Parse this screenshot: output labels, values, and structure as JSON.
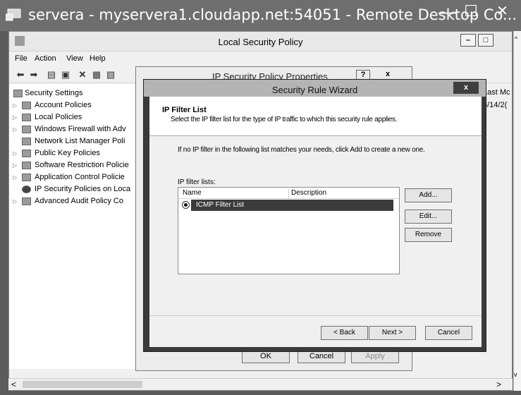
{
  "remote_desktop": {
    "title": "servera - myservera1.cloudapp.net:54051 - Remote Desktop Co...",
    "minimize": "—",
    "maximize": "☐",
    "close": "✕"
  },
  "lsp": {
    "title": "Local Security Policy",
    "min": "–",
    "max": "□",
    "menu": [
      "File",
      "Action",
      "View",
      "Help"
    ],
    "tree": [
      {
        "label": "Security Settings",
        "indent": 0,
        "expander": "",
        "selected": false
      },
      {
        "label": "Account Policies",
        "indent": 1,
        "expander": "▷",
        "selected": false
      },
      {
        "label": "Local Policies",
        "indent": 1,
        "expander": "▷",
        "selected": false
      },
      {
        "label": "Windows Firewall with Adv",
        "indent": 1,
        "expander": "▷",
        "selected": false
      },
      {
        "label": "Network List Manager Poli",
        "indent": 1,
        "expander": "",
        "selected": false
      },
      {
        "label": "Public Key Policies",
        "indent": 1,
        "expander": "▷",
        "selected": false
      },
      {
        "label": "Software Restriction Policie",
        "indent": 1,
        "expander": "▷",
        "selected": false
      },
      {
        "label": "Application Control Policie",
        "indent": 1,
        "expander": "▷",
        "selected": false
      },
      {
        "label": "IP Security Policies on Loca",
        "indent": 1,
        "expander": "",
        "selected": false
      },
      {
        "label": "Advanced Audit Policy Co",
        "indent": 1,
        "expander": "▷",
        "selected": false
      }
    ],
    "detail": {
      "col_header": "Last Mc",
      "value": "6/14/2("
    }
  },
  "props": {
    "title": "IP Security Policy Properties",
    "help": "?",
    "close": "x",
    "ok": "OK",
    "cancel": "Cancel",
    "apply": "Apply"
  },
  "wizard": {
    "title": "Security Rule Wizard",
    "close": "x",
    "header_title": "IP Filter List",
    "header_subtitle": "Select the IP filter list for the type of IP traffic to which this security rule applies.",
    "info": "If no IP filter in the following list matches your needs, click Add to create a new one.",
    "lists_label": "IP filter lists:",
    "columns": {
      "name": "Name",
      "description": "Description"
    },
    "rows": [
      {
        "name": "ICMP Filter List",
        "description": ""
      }
    ],
    "add": "Add...",
    "edit": "Edit...",
    "remove": "Remove",
    "back": "< Back",
    "next": "Next >",
    "cancel": "Cancel"
  }
}
